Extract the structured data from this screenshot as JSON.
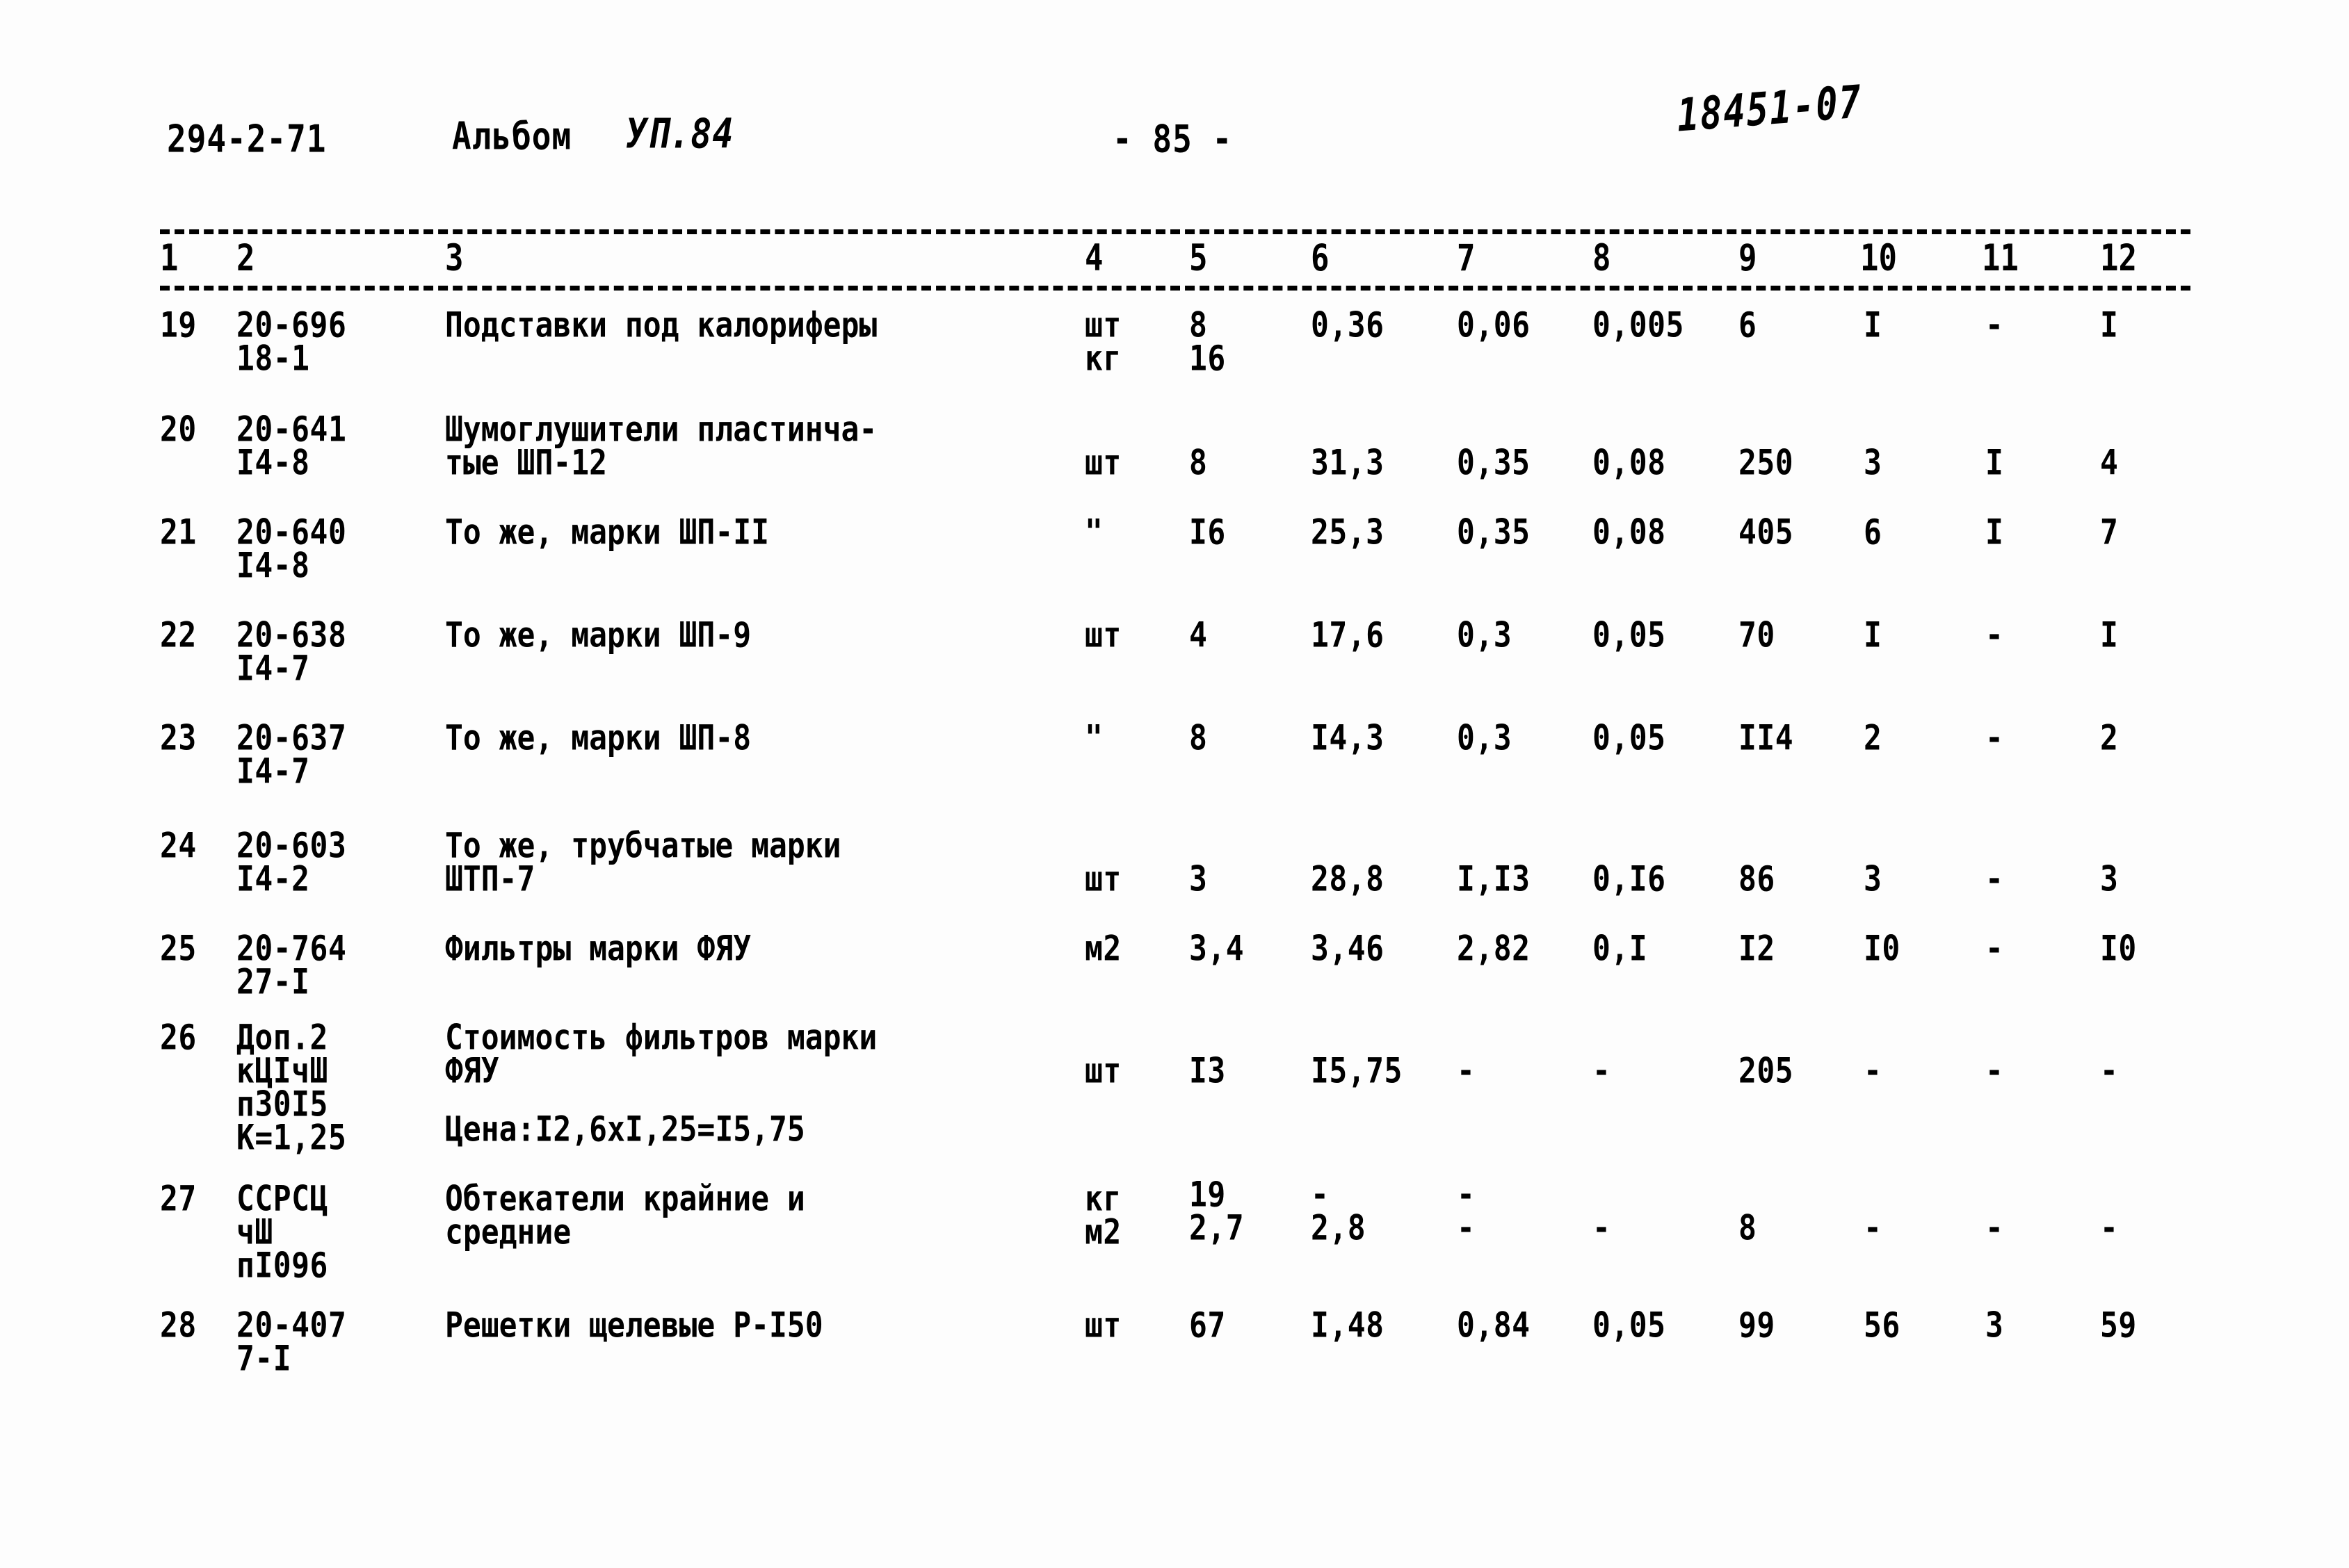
{
  "header": {
    "doc_code": "294-2-71",
    "album_label": "Альбом",
    "album_value": "УП.84",
    "page_number": "- 85 -",
    "stamp_code": "18451-07"
  },
  "table": {
    "column_numbers": [
      "1",
      "2",
      "3",
      "4",
      "5",
      "6",
      "7",
      "8",
      "9",
      "10",
      "11",
      "12"
    ],
    "rows": [
      {
        "no": "19",
        "code": "20-696",
        "code2": "18-1",
        "desc": "Подставки под калориферы",
        "desc2": "",
        "unit": "шт",
        "unit2": "кг",
        "qty": "8",
        "qty2": "16",
        "c6": "0,36",
        "c7": "0,06",
        "c8": "0,005",
        "c9": "6",
        "c10": "I",
        "c11": "-",
        "c12": "I"
      },
      {
        "no": "20",
        "code": "20-641",
        "code2": "I4-8",
        "desc": "Шумоглушители пластинча-",
        "desc2": "тые ШП-12",
        "unit": "шт",
        "unit2": "",
        "qty": "8",
        "qty2": "",
        "c6": "31,3",
        "c7": "0,35",
        "c8": "0,08",
        "c9": "250",
        "c10": "3",
        "c11": "I",
        "c12": "4"
      },
      {
        "no": "21",
        "code": "20-640",
        "code2": "I4-8",
        "desc": "То же, марки ШП-II",
        "desc2": "",
        "unit": "\"",
        "unit2": "",
        "qty": "I6",
        "qty2": "",
        "c6": "25,3",
        "c7": "0,35",
        "c8": "0,08",
        "c9": "405",
        "c10": "6",
        "c11": "I",
        "c12": "7"
      },
      {
        "no": "22",
        "code": "20-638",
        "code2": "I4-7",
        "desc": "То же, марки ШП-9",
        "desc2": "",
        "unit": "шт",
        "unit2": "",
        "qty": "4",
        "qty2": "",
        "c6": "17,6",
        "c7": "0,3",
        "c8": "0,05",
        "c9": "70",
        "c10": "I",
        "c11": "-",
        "c12": "I"
      },
      {
        "no": "23",
        "code": "20-637",
        "code2": "I4-7",
        "desc": "То же, марки ШП-8",
        "desc2": "",
        "unit": "\"",
        "unit2": "",
        "qty": "8",
        "qty2": "",
        "c6": "I4,3",
        "c7": "0,3",
        "c8": "0,05",
        "c9": "II4",
        "c10": "2",
        "c11": "-",
        "c12": "2"
      },
      {
        "no": "24",
        "code": "20-603",
        "code2": "I4-2",
        "desc": "То же, трубчатые марки",
        "desc2": "ШТП-7",
        "unit": "шт",
        "unit2": "",
        "qty": "3",
        "qty2": "",
        "c6": "28,8",
        "c7": "I,I3",
        "c8": "0,I6",
        "c9": "86",
        "c10": "3",
        "c11": "-",
        "c12": "3"
      },
      {
        "no": "25",
        "code": "20-764",
        "code2": "27-I",
        "desc": "Фильтры марки ФЯУ",
        "desc2": "",
        "unit": "м2",
        "unit2": "",
        "qty": "3,4",
        "qty2": "",
        "c6": "3,46",
        "c7": "2,82",
        "c8": "0,I",
        "c9": "I2",
        "c10": "I0",
        "c11": "-",
        "c12": "I0"
      },
      {
        "no": "26",
        "code": "Доп.2",
        "code2": "кЦIчШ",
        "code3": "п30I5",
        "code4": "К=1,25",
        "desc": "Стоимость фильтров марки",
        "desc2": "ФЯУ",
        "desc3": "Цена:I2,6xI,25=I5,75",
        "unit": "шт",
        "unit2": "",
        "qty": "I3",
        "qty2": "",
        "c6": "I5,75",
        "c7": "-",
        "c8": "-",
        "c9": "205",
        "c10": "-",
        "c11": "-",
        "c12": "-"
      },
      {
        "no": "27",
        "code": "ССРСЦ",
        "code2": "чШ",
        "code3": "пI096",
        "desc": "Обтекатели крайние и",
        "desc2": "средние",
        "unit": "кг",
        "unit2": "м2",
        "qty": "19",
        "qty2": "2,7",
        "c6": "-",
        "c6b": "2,8",
        "c7": "-",
        "c7b": "-",
        "c8": "-",
        "c9": "8",
        "c10": "-",
        "c11": "-",
        "c12": "-"
      },
      {
        "no": "28",
        "code": "20-407",
        "code2": "7-I",
        "desc": "Решетки щелевые Р-I50",
        "desc2": "",
        "unit": "шт",
        "unit2": "",
        "qty": "67",
        "qty2": "",
        "c6": "I,48",
        "c7": "0,84",
        "c8": "0,05",
        "c9": "99",
        "c10": "56",
        "c11": "3",
        "c12": "59"
      }
    ]
  }
}
